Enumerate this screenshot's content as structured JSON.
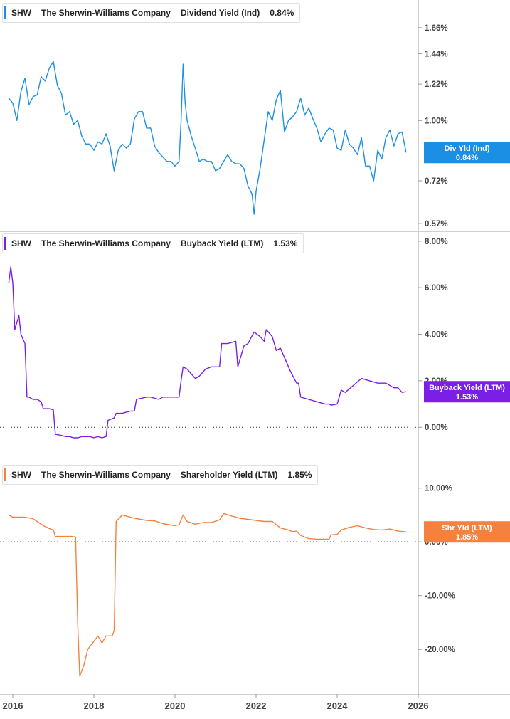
{
  "x_ticks": [
    "2016",
    "2018",
    "2020",
    "2022",
    "2024",
    "2026"
  ],
  "chart_data": [
    {
      "type": "line",
      "ticker": "SHW",
      "company": "The Sherwin-Williams Company",
      "metric": "Dividend Yield (Ind)",
      "legend_value": "0.84%",
      "label_name": "Div Yld (Ind)",
      "label_value": "0.84%",
      "color": "#1a8fe3",
      "scale": "log",
      "y_ticks": [
        "1.66%",
        "1.44%",
        "1.22%",
        "1.00%",
        "0.72%",
        "0.57%"
      ],
      "y_tick_values": [
        1.66,
        1.44,
        1.22,
        1.0,
        0.72,
        0.57
      ],
      "ylim": [
        0.555,
        1.9
      ],
      "x": [
        2015.9,
        2016.0,
        2016.1,
        2016.2,
        2016.3,
        2016.4,
        2016.5,
        2016.6,
        2016.7,
        2016.8,
        2016.9,
        2017.0,
        2017.1,
        2017.2,
        2017.3,
        2017.4,
        2017.5,
        2017.6,
        2017.7,
        2017.8,
        2017.9,
        2018.0,
        2018.1,
        2018.2,
        2018.3,
        2018.4,
        2018.5,
        2018.6,
        2018.7,
        2018.8,
        2018.9,
        2019.0,
        2019.1,
        2019.2,
        2019.3,
        2019.4,
        2019.5,
        2019.6,
        2019.7,
        2019.8,
        2019.9,
        2020.0,
        2020.1,
        2020.15,
        2020.2,
        2020.25,
        2020.3,
        2020.4,
        2020.5,
        2020.6,
        2020.7,
        2020.8,
        2020.9,
        2021.0,
        2021.1,
        2021.2,
        2021.3,
        2021.4,
        2021.5,
        2021.6,
        2021.7,
        2021.8,
        2021.9,
        2021.95,
        2022.0,
        2022.1,
        2022.2,
        2022.3,
        2022.4,
        2022.5,
        2022.6,
        2022.7,
        2022.8,
        2022.9,
        2023.0,
        2023.1,
        2023.2,
        2023.3,
        2023.4,
        2023.5,
        2023.6,
        2023.7,
        2023.8,
        2023.9,
        2024.0,
        2024.1,
        2024.2,
        2024.3,
        2024.4,
        2024.5,
        2024.6,
        2024.7,
        2024.8,
        2024.9,
        2025.0,
        2025.1,
        2025.2,
        2025.3,
        2025.4,
        2025.5,
        2025.6,
        2025.7
      ],
      "values": [
        1.13,
        1.1,
        1.0,
        1.17,
        1.26,
        1.09,
        1.14,
        1.15,
        1.27,
        1.24,
        1.33,
        1.38,
        1.21,
        1.16,
        1.03,
        1.05,
        0.98,
        1.0,
        0.92,
        0.88,
        0.88,
        0.85,
        0.89,
        0.88,
        0.93,
        0.87,
        0.76,
        0.85,
        0.88,
        0.86,
        0.88,
        1.01,
        1.05,
        1.05,
        0.96,
        0.96,
        0.87,
        0.84,
        0.82,
        0.8,
        0.8,
        0.78,
        0.8,
        1.0,
        1.36,
        1.1,
        1.0,
        0.92,
        0.86,
        0.8,
        0.81,
        0.8,
        0.8,
        0.76,
        0.77,
        0.8,
        0.83,
        0.8,
        0.79,
        0.79,
        0.77,
        0.7,
        0.67,
        0.6,
        0.68,
        0.77,
        0.9,
        1.05,
        1.0,
        1.12,
        1.18,
        0.94,
        1.0,
        1.02,
        1.05,
        1.13,
        1.03,
        1.07,
        1.01,
        0.96,
        0.89,
        0.93,
        0.96,
        0.95,
        0.86,
        0.85,
        0.95,
        0.88,
        0.86,
        0.83,
        0.91,
        0.78,
        0.78,
        0.72,
        0.85,
        0.81,
        0.91,
        0.95,
        0.87,
        0.93,
        0.94,
        0.84
      ]
    },
    {
      "type": "line",
      "ticker": "SHW",
      "company": "The Sherwin-Williams Company",
      "metric": "Buyback Yield (LTM)",
      "legend_value": "1.53%",
      "label_name": "Buyback Yield (LTM)",
      "label_value": "1.53%",
      "color": "#7b1ee6",
      "scale": "linear",
      "y_ticks": [
        "8.00%",
        "6.00%",
        "4.00%",
        "2.00%",
        "0.00%"
      ],
      "y_tick_values": [
        8,
        6,
        4,
        2,
        0
      ],
      "ylim": [
        -1.4,
        8.3
      ],
      "zero_line": true,
      "x": [
        2015.9,
        2015.95,
        2016.0,
        2016.05,
        2016.1,
        2016.15,
        2016.2,
        2016.3,
        2016.35,
        2016.4,
        2016.5,
        2016.6,
        2016.7,
        2016.75,
        2016.9,
        2017.0,
        2017.05,
        2017.2,
        2017.3,
        2017.4,
        2017.5,
        2017.6,
        2017.7,
        2017.8,
        2017.9,
        2018.0,
        2018.1,
        2018.2,
        2018.3,
        2018.35,
        2018.5,
        2018.55,
        2018.7,
        2018.9,
        2019.0,
        2019.05,
        2019.3,
        2019.4,
        2019.6,
        2019.7,
        2020.0,
        2020.1,
        2020.15,
        2020.2,
        2020.3,
        2020.5,
        2020.6,
        2020.75,
        2020.9,
        2021.1,
        2021.15,
        2021.3,
        2021.5,
        2021.55,
        2021.7,
        2021.8,
        2021.95,
        2022.1,
        2022.2,
        2022.25,
        2022.4,
        2022.5,
        2022.6,
        2022.7,
        2022.75,
        2022.85,
        2023.0,
        2023.05,
        2023.1,
        2023.3,
        2023.5,
        2023.7,
        2023.8,
        2023.85,
        2024.0,
        2024.1,
        2024.2,
        2024.4,
        2024.6,
        2024.8,
        2025.0,
        2025.2,
        2025.4,
        2025.5,
        2025.6,
        2025.7
      ],
      "values": [
        6.2,
        6.9,
        6.2,
        4.2,
        4.5,
        4.8,
        4.0,
        3.6,
        1.3,
        1.3,
        1.2,
        1.2,
        1.1,
        0.8,
        0.8,
        0.75,
        -0.3,
        -0.35,
        -0.4,
        -0.4,
        -0.45,
        -0.45,
        -0.4,
        -0.4,
        -0.4,
        -0.45,
        -0.4,
        -0.45,
        -0.4,
        0.3,
        0.4,
        0.6,
        0.6,
        0.7,
        0.7,
        1.2,
        1.3,
        1.3,
        1.2,
        1.3,
        1.3,
        1.3,
        2.0,
        2.6,
        2.5,
        2.1,
        2.2,
        2.5,
        2.6,
        2.6,
        3.6,
        3.6,
        3.7,
        2.6,
        3.5,
        3.6,
        4.1,
        3.9,
        3.7,
        4.2,
        3.9,
        3.3,
        3.4,
        3.0,
        2.8,
        2.4,
        1.9,
        1.9,
        1.3,
        1.2,
        1.1,
        1.0,
        1.0,
        0.95,
        1.0,
        1.6,
        1.5,
        1.8,
        2.1,
        2.0,
        1.9,
        1.9,
        1.7,
        1.7,
        1.5,
        1.53
      ]
    },
    {
      "type": "line",
      "ticker": "SHW",
      "company": "The Sherwin-Williams Company",
      "metric": "Shareholder Yield (LTM)",
      "legend_value": "1.85%",
      "label_name": "Shr Yld (LTM)",
      "label_value": "1.85%",
      "color": "#f5813f",
      "scale": "linear",
      "y_ticks": [
        "10.00%",
        "0.00%",
        "-10.00%",
        "-20.00%"
      ],
      "y_tick_values": [
        10,
        0,
        -10,
        -20
      ],
      "ylim": [
        -27.8,
        14.2
      ],
      "zero_line": true,
      "x": [
        2015.9,
        2016.0,
        2016.3,
        2016.5,
        2016.6,
        2016.75,
        2016.9,
        2017.0,
        2017.05,
        2017.3,
        2017.45,
        2017.55,
        2017.6,
        2017.65,
        2017.75,
        2017.85,
        2017.9,
        2018.0,
        2018.1,
        2018.2,
        2018.3,
        2018.45,
        2018.5,
        2018.55,
        2018.7,
        2019.0,
        2019.3,
        2019.5,
        2019.7,
        2020.0,
        2020.1,
        2020.2,
        2020.3,
        2020.5,
        2020.7,
        2020.9,
        2021.1,
        2021.2,
        2021.4,
        2021.6,
        2021.8,
        2022.0,
        2022.2,
        2022.4,
        2022.6,
        2022.8,
        2022.9,
        2023.0,
        2023.1,
        2023.3,
        2023.5,
        2023.8,
        2023.85,
        2024.0,
        2024.1,
        2024.3,
        2024.5,
        2024.7,
        2024.9,
        2025.1,
        2025.3,
        2025.5,
        2025.7
      ],
      "values": [
        5.0,
        4.6,
        4.6,
        4.3,
        3.8,
        3.0,
        2.5,
        2.2,
        1.0,
        1.0,
        1.0,
        0.9,
        -15.0,
        -25.0,
        -23.0,
        -20.0,
        -19.5,
        -18.5,
        -17.5,
        -18.8,
        -17.5,
        -17.5,
        -16.5,
        3.8,
        5.0,
        4.4,
        4.0,
        3.9,
        3.4,
        3.0,
        3.2,
        5.0,
        3.8,
        3.3,
        3.6,
        3.6,
        4.1,
        5.3,
        4.8,
        4.4,
        4.2,
        4.0,
        3.8,
        3.8,
        2.6,
        2.2,
        1.9,
        2.0,
        1.2,
        0.6,
        0.5,
        0.5,
        1.3,
        1.4,
        2.2,
        2.7,
        3.0,
        2.6,
        2.3,
        2.2,
        2.4,
        2.0,
        1.85
      ]
    }
  ]
}
